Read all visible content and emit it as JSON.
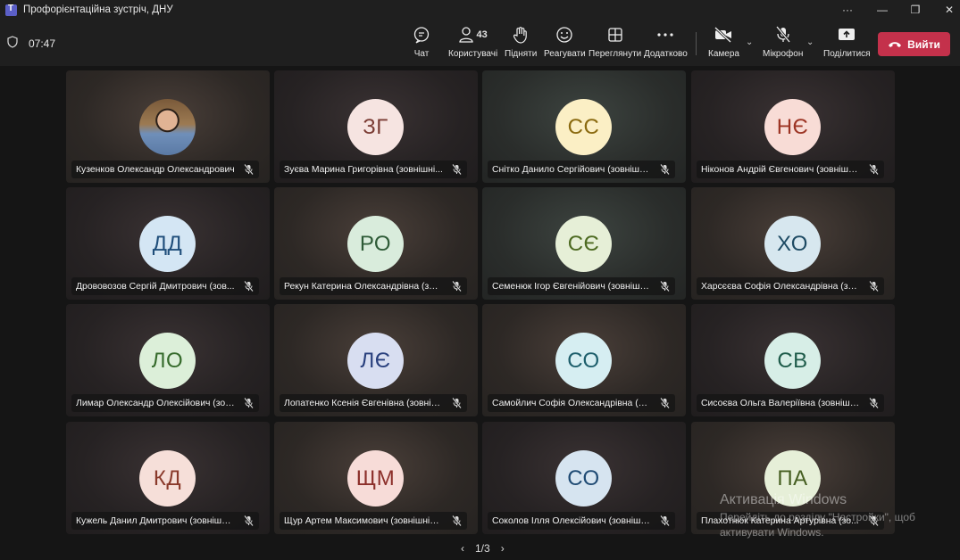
{
  "window": {
    "title": "Профорієнтаційна зустріч, ДНУ",
    "more": "···",
    "minimize": "—",
    "restore": "❐",
    "close": "✕"
  },
  "toolbar": {
    "timer": "07:47",
    "chat": "Чат",
    "people": "Користувачі",
    "people_count": "43",
    "raise": "Підняти",
    "react": "Реагувати",
    "view": "Переглянути",
    "more": "Додатково",
    "camera": "Камера",
    "mic": "Мікрофон",
    "share": "Поділитися",
    "leave": "Вийти"
  },
  "participants": [
    {
      "name": "Кузенков Олександр Олександрович",
      "initials": "",
      "color": "",
      "fg": ""
    },
    {
      "name": "Зуєва Марина Григорівна (зовнішні...",
      "initials": "ЗГ",
      "color": "#f6e4e1",
      "fg": "#7a3b33"
    },
    {
      "name": "Снітко Данило Сергійович (зовнішні...",
      "initials": "СС",
      "color": "#fbefc5",
      "fg": "#8a6a10"
    },
    {
      "name": "Ніконов Андрій Євгенович (зовнішні...",
      "initials": "НЄ",
      "color": "#f8dcd6",
      "fg": "#9c3424"
    },
    {
      "name": "Дрововозов Сергій Дмитрович (зов...",
      "initials": "ДД",
      "color": "#d4e6f4",
      "fg": "#1f4e7a"
    },
    {
      "name": "Рекун Катерина Олександрівна (зов...",
      "initials": "РО",
      "color": "#d9ecdc",
      "fg": "#2d5a36"
    },
    {
      "name": "Семенюк Ігор Євгенійович (зовнішні...",
      "initials": "СЄ",
      "color": "#e6efd7",
      "fg": "#4d6a21"
    },
    {
      "name": "Харсєєва Софія Олександрівна (зовн...",
      "initials": "ХО",
      "color": "#d7e7ef",
      "fg": "#1d4a63"
    },
    {
      "name": "Лимар Олександр Олексійович (зов...",
      "initials": "ЛО",
      "color": "#dcefd9",
      "fg": "#356a2b"
    },
    {
      "name": "Лопатенко Ксенія Євгенівна (зовніш...",
      "initials": "ЛЄ",
      "color": "#d8def1",
      "fg": "#283f7d"
    },
    {
      "name": "Самойлич Софія Олександрівна (зов...",
      "initials": "СО",
      "color": "#d6eef2",
      "fg": "#1d5e6b"
    },
    {
      "name": "Сисоєва Ольга Валеріївна (зовнішні...",
      "initials": "СВ",
      "color": "#d7eee7",
      "fg": "#1e5b4a"
    },
    {
      "name": "Кужель Данил Дмитрович (зовнішні...",
      "initials": "КД",
      "color": "#f6dfd9",
      "fg": "#8a3a2b"
    },
    {
      "name": "Щур Артем Максимович (зовнішній ...",
      "initials": "ЩМ",
      "color": "#f7dcd8",
      "fg": "#8c2f2a"
    },
    {
      "name": "Соколов Ілля Олексійович (зовнішні...",
      "initials": "СО",
      "color": "#d6e4f0",
      "fg": "#1f4a73"
    },
    {
      "name": "Плахотнюк Катерина Артурівна (зо...",
      "initials": "ПА",
      "color": "#e6efd8",
      "fg": "#465f22"
    }
  ],
  "pager": {
    "label": "1/3",
    "prev": "‹",
    "next": "›"
  },
  "watermark": {
    "line1": "Активація Windows",
    "line2": "Перейдіть до розділу \"Настройки\", щоб",
    "line3": "активувати Windows."
  }
}
